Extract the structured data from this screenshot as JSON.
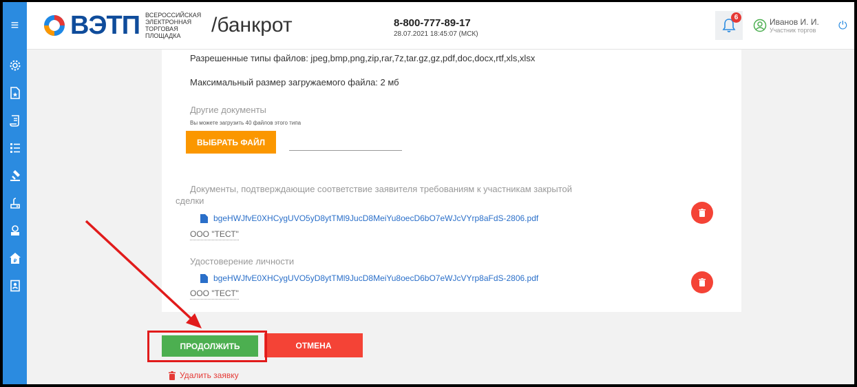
{
  "header": {
    "logo_text": "ВЭТП",
    "logo_sub": [
      "Всероссийская",
      "электронная",
      "торговая площадка"
    ],
    "section": "/банкрот",
    "phone": "8-800-777-89-17",
    "datetime": "28.07.2021 18:45:07 (МСК)",
    "notifications_count": "6",
    "user_name": "Иванов И. И.",
    "user_role": "Участник торгов"
  },
  "sidebar": {
    "icons": [
      "settings-icon",
      "document-star-icon",
      "scroll-icon",
      "list-icon",
      "gavel-icon",
      "auction-icon",
      "auction-alt-icon",
      "bank-icon",
      "contacts-icon"
    ]
  },
  "form": {
    "allowed_types": "Разрешенные типы файлов: jpeg,bmp,png,zip,rar,7z,tar.gz,gz,pdf,doc,docx,rtf,xls,xlsx",
    "max_size": "Максимальный размер загружаемого файла: 2 мб",
    "other_docs_label": "Другие документы",
    "other_docs_hint": "Вы можете загрузить 40 файлов этого типа",
    "choose_file": "ВЫБРАТЬ ФАЙЛ",
    "docs": [
      {
        "label_line1": "Документы, подтверждающие соответствие заявителя требованиям к участникам закрытой",
        "label_line2": "сделки",
        "file": "bgeHWJfvE0XHCygUVO5yD8ytTMl9JucD8MeiYu8oecD6bO7eWJcVYrp8aFdS-2806.pdf",
        "org": "ООО \"ТЕСТ\""
      },
      {
        "label_line1": "Удостоверение личности",
        "file": "bgeHWJfvE0XHCygUVO5yD8ytTMl9JucD8MeiYu8oecD6bO7eWJcVYrp8aFdS-2806.pdf",
        "org": "ООО \"ТЕСТ\""
      }
    ]
  },
  "actions": {
    "continue": "ПРОДОЛЖИТЬ",
    "cancel": "ОТМЕНА",
    "delete_application": "Удалить заявку"
  },
  "colors": {
    "primary_blue": "#2b8be0",
    "orange": "#fb9700",
    "green": "#4caf50",
    "red": "#f44336",
    "annotation_red": "#e11b1b"
  }
}
